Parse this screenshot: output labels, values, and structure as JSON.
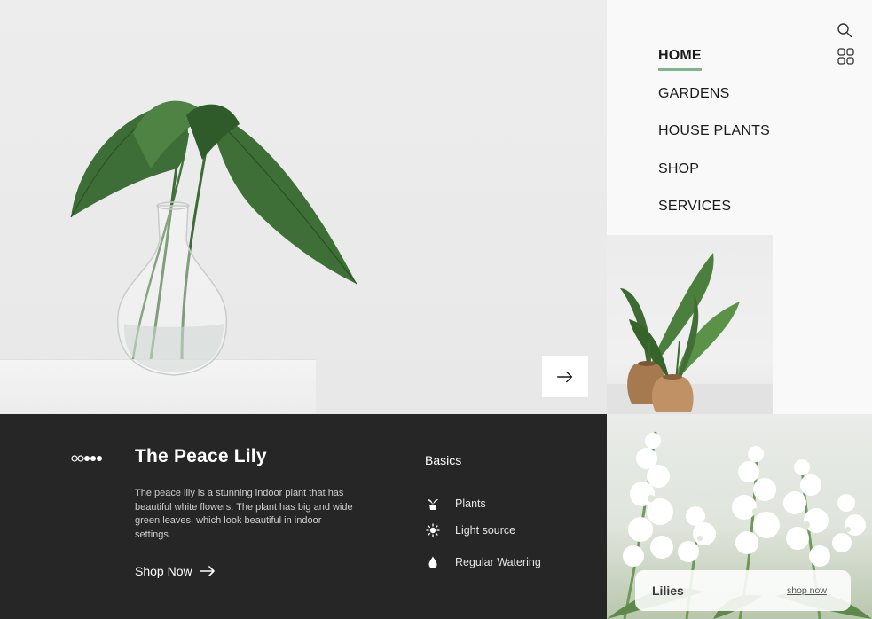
{
  "nav": {
    "items": [
      {
        "label": "HOME",
        "active": true
      },
      {
        "label": "GARDENS",
        "active": false
      },
      {
        "label": "HOUSE PLANTS",
        "active": false
      },
      {
        "label": "SHOP",
        "active": false
      },
      {
        "label": "SERVICES",
        "active": false
      }
    ],
    "icons": [
      "search-icon",
      "grid-icon"
    ]
  },
  "hero": {
    "next_icon": "arrow-right-icon"
  },
  "product": {
    "carousel_icon": "dots-indicator-icon",
    "title": "The Peace Lily",
    "description": "The peace lily is a stunning indoor plant that has beautiful white flowers. The plant has big and wide green leaves, which look beautiful in indoor settings.",
    "cta_label": "Shop Now",
    "cta_icon": "arrow-right-icon"
  },
  "basics": {
    "title": "Basics",
    "items": [
      {
        "label": "Plants",
        "icon": "plant-pot-icon"
      },
      {
        "label": "Light source",
        "icon": "sun-icon"
      },
      {
        "label": "Regular Watering",
        "icon": "water-drop-icon"
      }
    ]
  },
  "feature_card": {
    "label": "Lilies",
    "link": "shop now"
  },
  "colors": {
    "accent_underline": "#7fb58f",
    "dark_panel": "#262626",
    "page_bg": "#fafafa"
  }
}
